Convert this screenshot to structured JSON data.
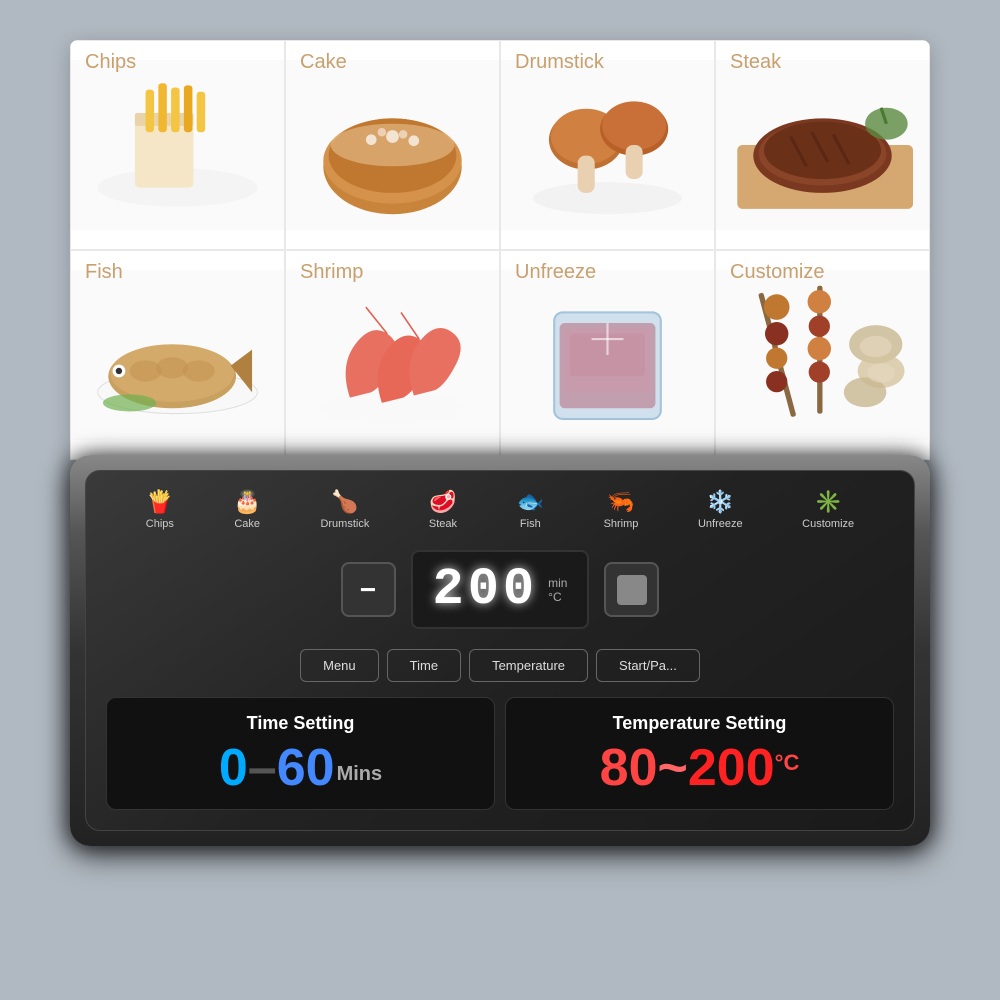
{
  "foodGrid": {
    "items": [
      {
        "id": "chips",
        "label": "Chips",
        "emoji": "🍟",
        "color": "#d4956a"
      },
      {
        "id": "cake",
        "label": "Cake",
        "emoji": "🎂",
        "color": "#c8855a"
      },
      {
        "id": "drumstick",
        "label": "Drumstick",
        "emoji": "🍗",
        "color": "#c07840"
      },
      {
        "id": "steak",
        "label": "Steak",
        "emoji": "🥩",
        "color": "#c07040"
      },
      {
        "id": "fish",
        "label": "Fish",
        "emoji": "🐟",
        "color": "#c8906e"
      },
      {
        "id": "shrimp",
        "label": "Shrimp",
        "emoji": "🦐",
        "color": "#d08060"
      },
      {
        "id": "unfreeze",
        "label": "Unfreeze",
        "emoji": "🧊",
        "color": "#b08060"
      },
      {
        "id": "customize",
        "label": "Customize",
        "emoji": "🍢",
        "color": "#b07850"
      }
    ]
  },
  "modeIcons": [
    {
      "id": "chips",
      "symbol": "🍟",
      "label": "Chips"
    },
    {
      "id": "cake",
      "symbol": "🎂",
      "label": "Cake"
    },
    {
      "id": "drumstick",
      "symbol": "🍗",
      "label": "Drumstick"
    },
    {
      "id": "steak",
      "symbol": "🥩",
      "label": "Steak"
    },
    {
      "id": "fish",
      "symbol": "🐟",
      "label": "Fish"
    },
    {
      "id": "shrimp",
      "symbol": "🦐",
      "label": "Shrimp"
    },
    {
      "id": "unfreeze",
      "symbol": "❄️",
      "label": "Unfreeze"
    },
    {
      "id": "customize",
      "symbol": "✳️",
      "label": "Customize"
    }
  ],
  "display": {
    "value": "200",
    "unit_min": "min",
    "unit_temp": "°C",
    "minus_label": "−",
    "plus_label": "+"
  },
  "functionButtons": [
    {
      "id": "menu",
      "label": "Menu"
    },
    {
      "id": "time",
      "label": "Time"
    },
    {
      "id": "temperature",
      "label": "Temperature"
    },
    {
      "id": "startpause",
      "label": "Start/Pa..."
    }
  ],
  "timeSetting": {
    "title": "Time Setting",
    "value_start": "0",
    "separator": "–",
    "value_end": "60",
    "suffix": "Mins"
  },
  "tempSetting": {
    "title": "Temperature Setting",
    "value_start": "80",
    "separator": "~",
    "value_end": "200",
    "suffix": "°C"
  }
}
